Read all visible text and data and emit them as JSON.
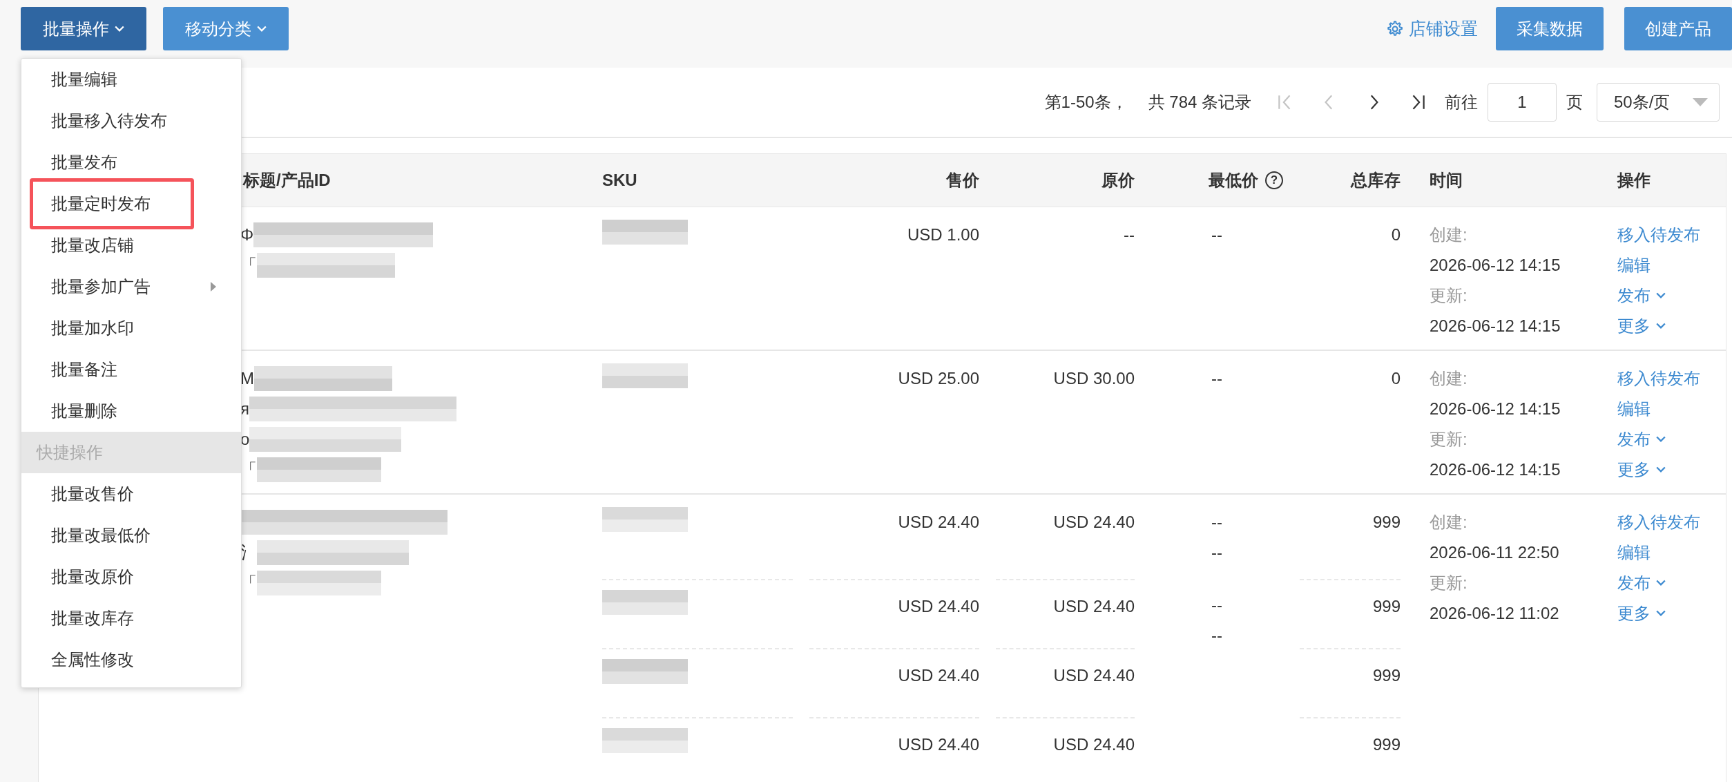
{
  "toolbar": {
    "menus": [
      {
        "label": "批量操作",
        "open": true
      },
      {
        "label": "移动分类",
        "open": false
      }
    ],
    "store_settings": "店铺设置",
    "actions": [
      "采集数据",
      "创建产品"
    ]
  },
  "bulk_menu": {
    "items": [
      {
        "kind": "item",
        "label": "批量编辑",
        "highlighted": false,
        "has_submenu": false
      },
      {
        "kind": "item",
        "label": "批量移入待发布",
        "highlighted": false,
        "has_submenu": false
      },
      {
        "kind": "item",
        "label": "批量发布",
        "highlighted": false,
        "has_submenu": false
      },
      {
        "kind": "item",
        "label": "批量定时发布",
        "highlighted": true,
        "has_submenu": false
      },
      {
        "kind": "item",
        "label": "批量改店铺",
        "highlighted": false,
        "has_submenu": false
      },
      {
        "kind": "item",
        "label": "批量参加广告",
        "highlighted": false,
        "has_submenu": true
      },
      {
        "kind": "item",
        "label": "批量加水印",
        "highlighted": false,
        "has_submenu": false
      },
      {
        "kind": "item",
        "label": "批量备注",
        "highlighted": false,
        "has_submenu": false
      },
      {
        "kind": "item",
        "label": "批量删除",
        "highlighted": false,
        "has_submenu": false
      },
      {
        "kind": "header",
        "label": "快捷操作"
      },
      {
        "kind": "item",
        "label": "批量改售价",
        "highlighted": false,
        "has_submenu": false
      },
      {
        "kind": "item",
        "label": "批量改最低价",
        "highlighted": false,
        "has_submenu": false
      },
      {
        "kind": "item",
        "label": "批量改原价",
        "highlighted": false,
        "has_submenu": false
      },
      {
        "kind": "item",
        "label": "批量改库存",
        "highlighted": false,
        "has_submenu": false
      },
      {
        "kind": "item",
        "label": "全属性修改",
        "highlighted": false,
        "has_submenu": false
      }
    ]
  },
  "pagination": {
    "range": "第1-50条，",
    "total": "共 784 条记录",
    "nav": [
      {
        "kind": "first",
        "disabled": true
      },
      {
        "kind": "prev",
        "disabled": true
      },
      {
        "kind": "next",
        "disabled": false
      },
      {
        "kind": "last",
        "disabled": false
      }
    ],
    "goto_label": "前往",
    "page": "1",
    "page_unit": "页",
    "page_size": "50条/页"
  },
  "table": {
    "columns": [
      {
        "label": "标题/产品ID"
      },
      {
        "label": "SKU"
      },
      {
        "label": "售价"
      },
      {
        "label": "原价"
      },
      {
        "label": "最低价",
        "help": "?"
      },
      {
        "label": "总库存"
      },
      {
        "label": "时间"
      },
      {
        "label": "操作"
      }
    ],
    "rows": [
      {
        "title_lines": [
          {
            "kind": "pixelated",
            "lead": "Φ"
          },
          {
            "kind": "pixelated",
            "lead": "「"
          }
        ],
        "variants": [
          {
            "price": "USD 1.00",
            "original_price": "--",
            "min_price": [
              "--"
            ],
            "stock": "0"
          }
        ],
        "created_label": "创建:",
        "created": "2026-06-12 14:15",
        "updated_label": "更新:",
        "updated": "2026-06-12 14:15",
        "actions": [
          {
            "label": "移入待发布",
            "dropdown": false
          },
          {
            "label": "编辑",
            "dropdown": false
          },
          {
            "label": "发布",
            "dropdown": true
          },
          {
            "label": "更多",
            "dropdown": true
          }
        ]
      },
      {
        "title_lines": [
          {
            "kind": "pixelated",
            "lead": "M"
          },
          {
            "kind": "pixelated",
            "lead": "я"
          },
          {
            "kind": "pixelated",
            "lead": "o"
          },
          {
            "kind": "pixelated",
            "lead": "「"
          }
        ],
        "variants": [
          {
            "price": "USD 25.00",
            "original_price": "USD 30.00",
            "min_price": [
              "--"
            ],
            "stock": "0"
          }
        ],
        "created_label": "创建:",
        "created": "2026-06-12 14:15",
        "updated_label": "更新:",
        "updated": "2026-06-12 14:15",
        "actions": [
          {
            "label": "移入待发布",
            "dropdown": false
          },
          {
            "label": "编辑",
            "dropdown": false
          },
          {
            "label": "发布",
            "dropdown": true
          },
          {
            "label": "更多",
            "dropdown": true
          }
        ]
      },
      {
        "title_lines": [
          {
            "kind": "pixelated"
          },
          {
            "kind": "pixelated",
            "lead": "氵"
          },
          {
            "kind": "pixelated",
            "lead": "「"
          }
        ],
        "variants": [
          {
            "price": "USD 24.40",
            "original_price": "USD 24.40",
            "min_price": [
              "--",
              "--"
            ],
            "stock": "999"
          },
          {
            "price": "USD 24.40",
            "original_price": "USD 24.40",
            "min_price": [
              "--",
              "--"
            ],
            "stock": "999"
          },
          {
            "price": "USD 24.40",
            "original_price": "USD 24.40",
            "stock": "999"
          },
          {
            "price": "USD 24.40",
            "original_price": "USD 24.40",
            "stock": "999"
          }
        ],
        "created_label": "创建:",
        "created": "2026-06-11 22:50",
        "updated_label": "更新:",
        "updated": "2026-06-12 11:02",
        "actions": [
          {
            "label": "移入待发布",
            "dropdown": false
          },
          {
            "label": "编辑",
            "dropdown": false
          },
          {
            "label": "发布",
            "dropdown": true
          },
          {
            "label": "更多",
            "dropdown": true
          }
        ]
      }
    ]
  }
}
